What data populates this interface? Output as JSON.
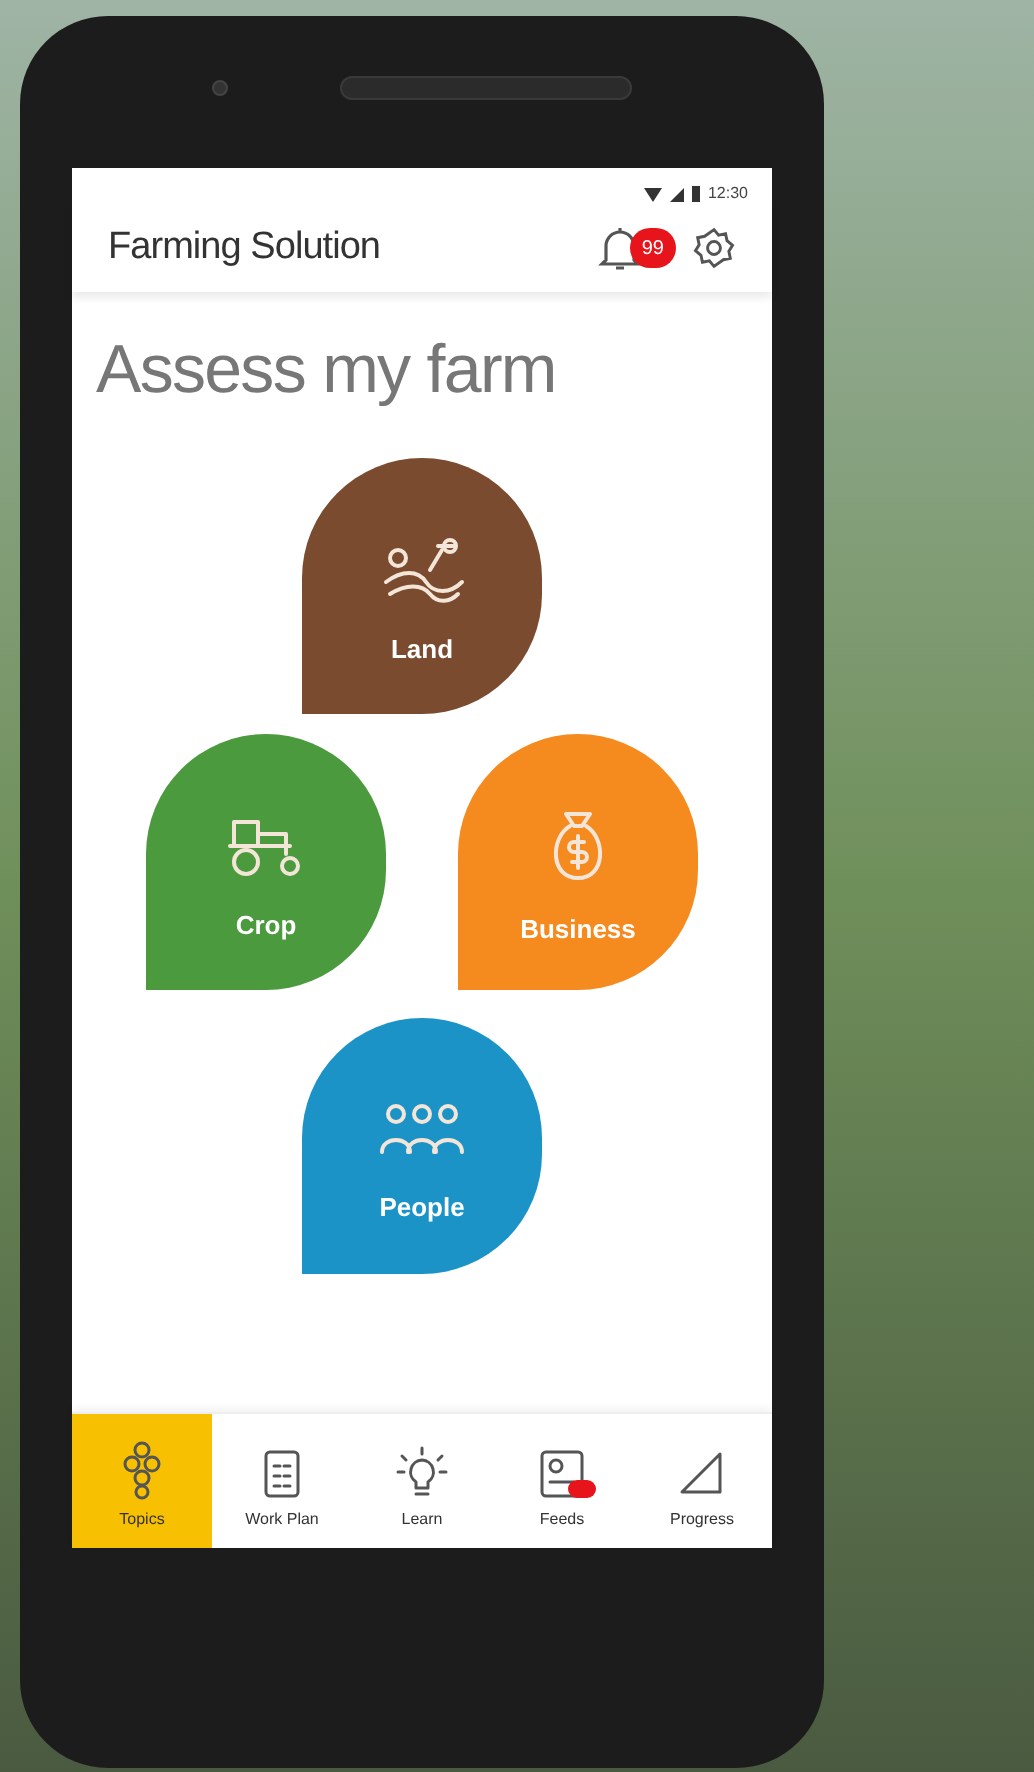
{
  "status_bar": {
    "time": "12:30"
  },
  "app_bar": {
    "title": "Farming Solution",
    "notification_count": "99"
  },
  "heading": "Assess my farm",
  "tiles": [
    {
      "kind": "land",
      "label": "Land",
      "color": "#7a4b2f"
    },
    {
      "kind": "crop",
      "label": "Crop",
      "color": "#4b9a3d"
    },
    {
      "kind": "business",
      "label": "Business",
      "color": "#f58a1f"
    },
    {
      "kind": "people",
      "label": "People",
      "color": "#1c93c7"
    }
  ],
  "nav": [
    {
      "kind": "topics",
      "label": "Topics",
      "selected": true
    },
    {
      "kind": "workplan",
      "label": "Work Plan",
      "selected": false
    },
    {
      "kind": "learn",
      "label": "Learn",
      "selected": false
    },
    {
      "kind": "feeds",
      "label": "Feeds",
      "selected": false,
      "badge": true
    },
    {
      "kind": "progress",
      "label": "Progress",
      "selected": false
    }
  ]
}
